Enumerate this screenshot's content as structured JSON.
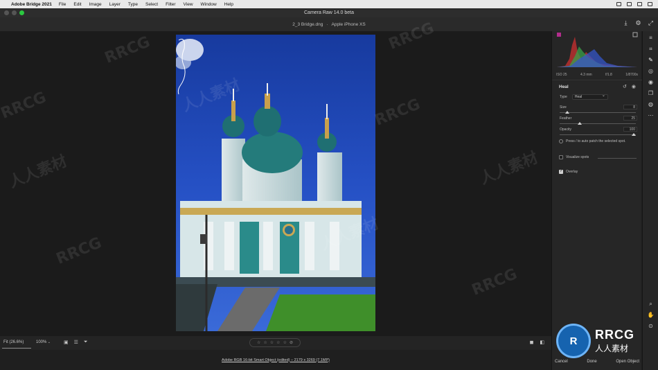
{
  "menubar": {
    "app_name": "Adobe Bridge 2021",
    "items": [
      "File",
      "Edit",
      "Image",
      "Layer",
      "Type",
      "Select",
      "Filter",
      "View",
      "Window",
      "Help"
    ]
  },
  "window": {
    "title": "Camera Raw 14.0 beta"
  },
  "file": {
    "name": "2_3 Bridge.dng",
    "camera": "Apple iPhone XS"
  },
  "exif": {
    "iso": "ISO 25",
    "focal": "4.3 mm",
    "aperture": "f/1.8",
    "shutter": "1/8700s"
  },
  "heal": {
    "title": "Heal",
    "type_label": "Type",
    "type_value": "Heal",
    "size_label": "Size",
    "size_value": "8",
    "size_fraction": 0.08,
    "feather_label": "Feather",
    "feather_value": "25",
    "feather_fraction": 0.25,
    "opacity_label": "Opacity",
    "opacity_value": "100",
    "opacity_fraction": 1.0,
    "hint": "Press / to auto patch the selected spot.",
    "visualize_label": "Visualize spots",
    "visualize_checked": false,
    "overlay_label": "Overlay",
    "overlay_checked": true
  },
  "bottom": {
    "fit_label": "Fit (26.6%)",
    "zoom_label": "100%",
    "status": "Adobe RGB 16-bit Smart Object (edited) – 2179 x 3269 (7.1MP)",
    "rating_stars": 5
  },
  "panel_buttons": {
    "cancel": "Cancel",
    "done": "Done",
    "open": "Open Object"
  },
  "watermarks": {
    "rrcg": "RRCG",
    "cn": "人人素材",
    "logo_big": "RRCG",
    "logo_small": "人人素材"
  },
  "colors": {
    "accent_sky": "#2346b3",
    "dome_teal": "#2a8b8a",
    "grass": "#3f8f2a"
  }
}
